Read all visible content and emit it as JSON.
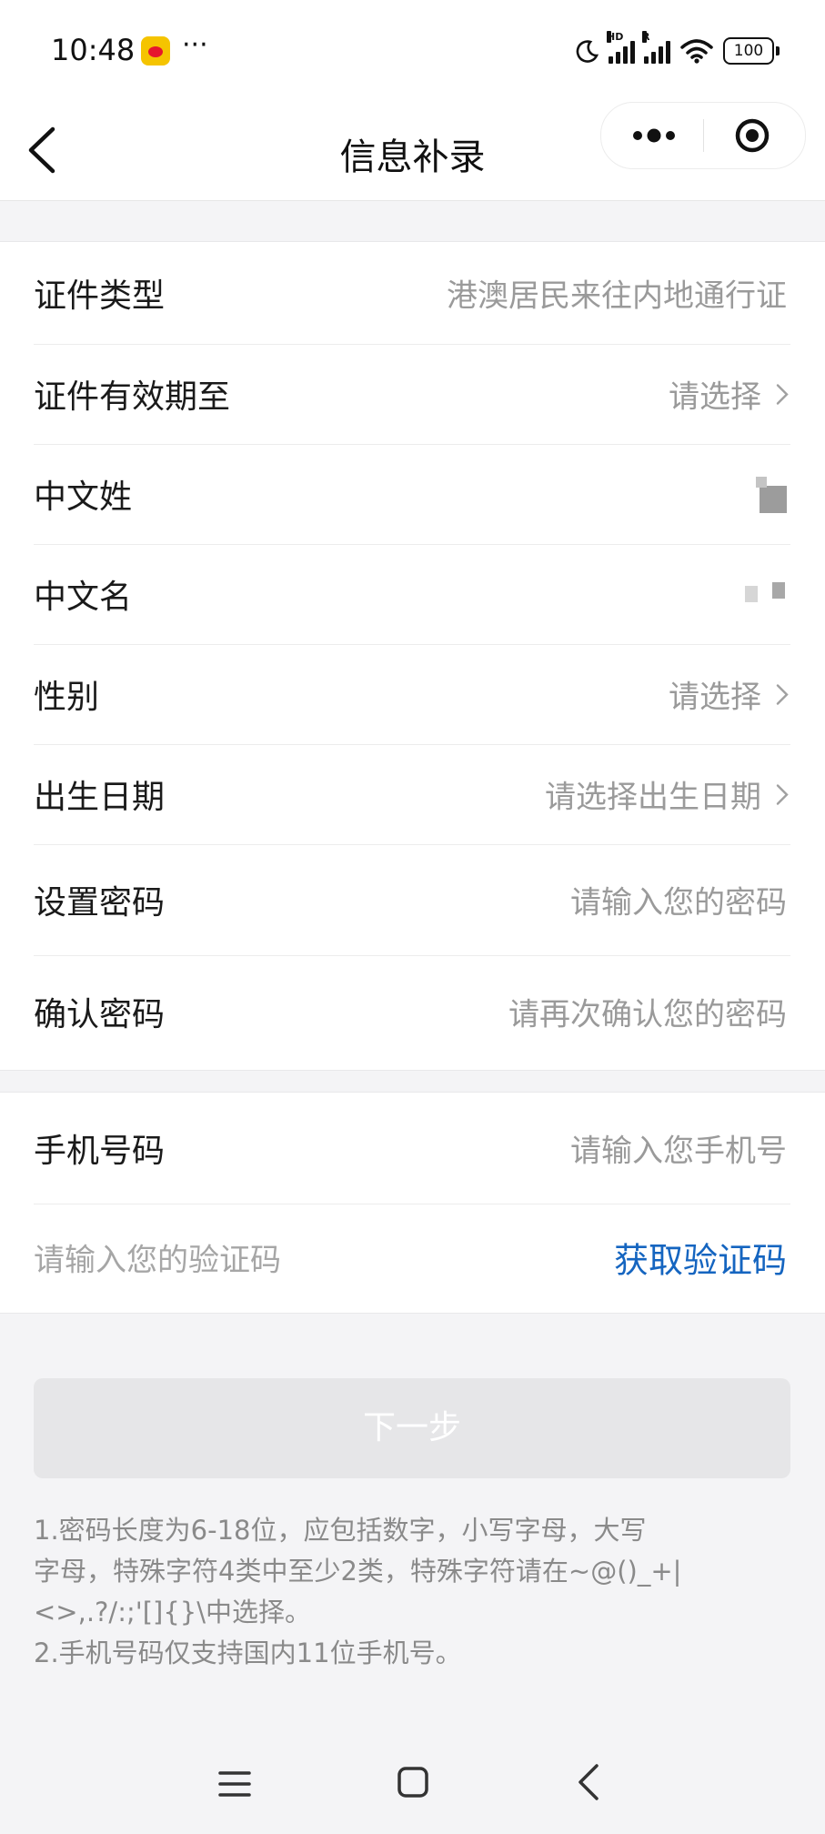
{
  "status_bar": {
    "time": "10:48",
    "more": "···",
    "net1_tag": "HD",
    "net2_tag": "R",
    "battery": "100"
  },
  "nav": {
    "title": "信息补录"
  },
  "form": {
    "rows": [
      {
        "label": "证件类型",
        "value": "港澳居民来往内地通行证"
      },
      {
        "label": "证件有效期至",
        "value": "请选择"
      },
      {
        "label": "中文姓",
        "value": ""
      },
      {
        "label": "中文名",
        "value": ""
      },
      {
        "label": "性别",
        "value": "请选择"
      },
      {
        "label": "出生日期",
        "value": "请选择出生日期"
      },
      {
        "label": "设置密码",
        "value": "请输入您的密码"
      },
      {
        "label": "确认密码",
        "value": "请再次确认您的密码"
      }
    ]
  },
  "phone": {
    "label": "手机号码",
    "placeholder": "请输入您手机号",
    "code_placeholder": "请输入您的验证码",
    "get_code": "获取验证码"
  },
  "next_label": "下一步",
  "notes": [
    "1.密码长度为6-18位，应包括数字，小写字母，大写",
    "字母，特殊字符4类中至少2类，特殊字符请在~@()_+|",
    "<>,.?/:;'[]{}\\中选择。",
    "2.手机号码仅支持国内11位手机号。"
  ],
  "colors": {
    "accent": "#1565c0",
    "background": "#f4f4f6",
    "placeholder": "#9a9a9a"
  }
}
